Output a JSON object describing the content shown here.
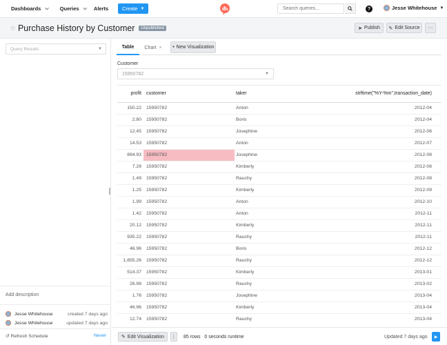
{
  "nav": {
    "dashboards": "Dashboards",
    "queries": "Queries",
    "alerts": "Alerts",
    "create": "Create",
    "search_placeholder": "Search queries...",
    "help": "?",
    "user_name": "Jesse Whitehouse"
  },
  "header": {
    "title": "Purchase History by Customer",
    "badge": "Unpublished",
    "publish": "Publish",
    "edit_source": "Edit Source",
    "more": "···"
  },
  "left": {
    "query_results_placeholder": "Query Results",
    "add_description": "Add description",
    "activity": [
      {
        "user": "Jesse Whitehouse",
        "when": "created 7 days ago"
      },
      {
        "user": "Jesse Whitehouse",
        "when": "updated 7 days ago"
      }
    ],
    "refresh_label": "Refresh Schedule",
    "refresh_value": "Never"
  },
  "tabs": {
    "table": "Table",
    "chart": "Chart",
    "chart_close": "×",
    "new_vis": "+ New Visualization"
  },
  "filter": {
    "label": "Customer",
    "value": "15950782"
  },
  "table": {
    "columns": [
      "profit",
      "customer",
      "taker",
      "strftime(\"%Y-%m\",transaction_date)"
    ],
    "rows": [
      [
        "150.22",
        "15950782",
        "Anton",
        "2012-04"
      ],
      [
        "2.80",
        "15950782",
        "Boris",
        "2012-04"
      ],
      [
        "12.45",
        "15950782",
        "Josephine",
        "2012-06"
      ],
      [
        "14.53",
        "15950782",
        "Anton",
        "2012-07"
      ],
      [
        "894.93",
        "15950782",
        "Josephine",
        "2012-08"
      ],
      [
        "7.28",
        "15950782",
        "Kimberly",
        "2012-08"
      ],
      [
        "1.49",
        "15950782",
        "Rauchy",
        "2012-08"
      ],
      [
        "1.25",
        "15950782",
        "Kimberly",
        "2012-09"
      ],
      [
        "1.99",
        "15950782",
        "Anton",
        "2012-10"
      ],
      [
        "1.42",
        "15950782",
        "Anton",
        "2012-11"
      ],
      [
        "20.12",
        "15950782",
        "Kimberly",
        "2012-11"
      ],
      [
        "935.22",
        "15950782",
        "Rauchy",
        "2012-11"
      ],
      [
        "46.96",
        "15950782",
        "Boris",
        "2012-12"
      ],
      [
        "1,655.26",
        "15950782",
        "Rauchy",
        "2012-12"
      ],
      [
        "514.37",
        "15950782",
        "Kimberly",
        "2013-01"
      ],
      [
        "26.98",
        "15950782",
        "Rauchy",
        "2013-02"
      ],
      [
        "1.76",
        "15950782",
        "Josephine",
        "2013-04"
      ],
      [
        "46.96",
        "15950782",
        "Kimberly",
        "2013-04"
      ],
      [
        "12.74",
        "15950782",
        "Rauchy",
        "2013-04"
      ]
    ],
    "highlight_row": 4,
    "highlight_color": "#f6bcc2"
  },
  "footer": {
    "edit_vis": "Edit Visualization",
    "kebab": "⋮",
    "rows": "85 rows",
    "runtime": "0 seconds runtime",
    "updated": "Updated 7 days ago"
  },
  "colors": {
    "accent": "#2196f3",
    "badge": "#8a97a6"
  }
}
